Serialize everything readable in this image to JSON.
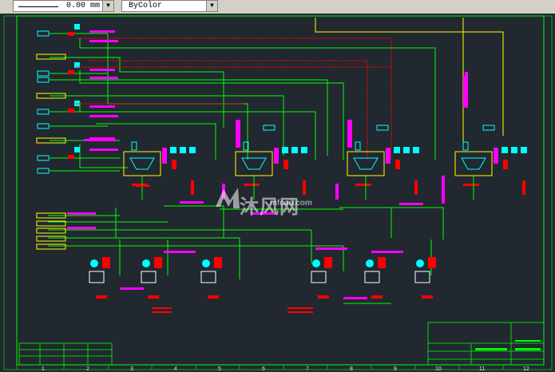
{
  "toolbar": {
    "lineweight_value": "0.00 mm",
    "plotstyle_value": "ByColor"
  },
  "watermark": {
    "text": "沐风网",
    "domain": "mfcad.com"
  },
  "ruler": {
    "columns": [
      "1",
      "2",
      "3",
      "4",
      "5",
      "6",
      "7",
      "8",
      "9",
      "10",
      "11",
      "12"
    ]
  },
  "colors": {
    "background": "#212830",
    "pipe_green": "#00ff00",
    "pipe_red": "#ff0000",
    "label_magenta": "#ff00ff",
    "equipment_cyan": "#00ffff",
    "line_yellow": "#ffff00",
    "border_white": "#ffffff"
  },
  "icons": [
    "chevron-down-icon",
    "watermark-logo-icon"
  ]
}
